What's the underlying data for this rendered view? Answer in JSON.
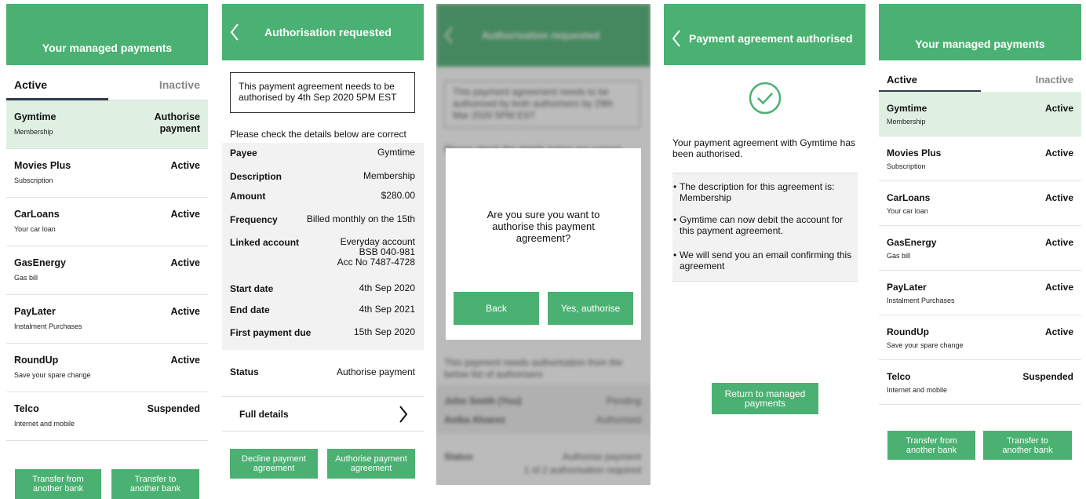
{
  "screen1": {
    "title": "Your managed payments",
    "tab_active": "Active",
    "tab_inactive": "Inactive",
    "rows": [
      {
        "name": "Gymtime",
        "sub": "Membership",
        "status": "Authorise payment"
      },
      {
        "name": "Movies Plus",
        "sub": "Subscription",
        "status": "Active"
      },
      {
        "name": "CarLoans",
        "sub": "Your car loan",
        "status": "Active"
      },
      {
        "name": "GasEnergy",
        "sub": "Gas bill",
        "status": "Active"
      },
      {
        "name": "PayLater",
        "sub": "Instalment Purchases",
        "status": "Active"
      },
      {
        "name": "RoundUp",
        "sub": "Save your spare change",
        "status": "Active"
      },
      {
        "name": "Telco",
        "sub": "Internet and mobile",
        "status": "Suspended"
      }
    ],
    "btn_transfer_from": "Transfer from another bank",
    "btn_transfer_to": "Transfer to another bank"
  },
  "screen2": {
    "title": "Authorisation requested",
    "notice": "This payment agreement needs to be authorised by 4th Sep 2020 5PM EST",
    "check_text": "Please check the details below are correct",
    "details": [
      {
        "label": "Payee",
        "value": "Gymtime"
      },
      {
        "label": "Description",
        "value": "Membership"
      },
      {
        "label": "Amount",
        "value": "$280.00"
      },
      {
        "label": "Frequency",
        "value": "Billed monthly on the 15th"
      },
      {
        "label": "Linked account",
        "value_lines": [
          "Everyday account",
          "BSB 040-981",
          "Acc No 7487-4728"
        ]
      },
      {
        "label": "Start date",
        "value": "4th Sep 2020"
      },
      {
        "label": "End date",
        "value": "4th Sep 2021"
      },
      {
        "label": "First payment due",
        "value": "15th Sep 2020"
      }
    ],
    "status_label": "Status",
    "status_value": "Authorise payment",
    "full_details": "Full details",
    "btn_decline": "Decline payment agreement",
    "btn_authorise": "Authorise payment agreement"
  },
  "screen3": {
    "bg_title": "Authorisation requested",
    "bg_notice": "This payment agreement needs to be authorised by both authorisers by 29th Mar 2020 5PM EST",
    "bg_check": "Please check the details below are correct",
    "bg_authorisers_text": "This payment needs authorisation from the below list of authorisers",
    "bg_authorisers": [
      {
        "name": "John Smith (You)",
        "state": "Pending"
      },
      {
        "name": "Anika Alvarez",
        "state": "Authorised"
      }
    ],
    "bg_status_label": "Status",
    "bg_status_value": "Authorise payment",
    "bg_status_sub": "1 of 2 authorisation required",
    "dialog_question": "Are you sure you want to authorise this payment agreement?",
    "btn_back": "Back",
    "btn_yes": "Yes, authorise"
  },
  "screen4": {
    "title": "Payment agreement authorised",
    "message": "Your payment agreement with Gymtime has been authorised.",
    "bullets": [
      "The description for this agreement is: Membership",
      "Gymtime can now debit the account for this payment agreement.",
      "We will send you an email confirming this agreement"
    ],
    "btn_return": "Return to managed payments"
  },
  "screen5": {
    "title": "Your managed payments",
    "tab_active": "Active",
    "tab_inactive": "Inactive",
    "rows": [
      {
        "name": "Gymtime",
        "sub": "Membership",
        "status": "Active"
      },
      {
        "name": "Movies Plus",
        "sub": "Subscription",
        "status": "Active"
      },
      {
        "name": "CarLoans",
        "sub": "Your car loan",
        "status": "Active"
      },
      {
        "name": "GasEnergy",
        "sub": "Gas bill",
        "status": "Active"
      },
      {
        "name": "PayLater",
        "sub": "Instalment Purchases",
        "status": "Active"
      },
      {
        "name": "RoundUp",
        "sub": "Save your spare change",
        "status": "Active"
      },
      {
        "name": "Telco",
        "sub": "Internet and mobile",
        "status": "Suspended"
      }
    ],
    "btn_transfer_from": "Transfer from another bank",
    "btn_transfer_to": "Transfer to another bank"
  },
  "colors": {
    "brand_green": "#4bb172",
    "highlight": "#dff0e3",
    "tab_underline": "#2f3a4d"
  },
  "icons": [
    "chevron-left-icon",
    "chevron-right-icon",
    "check-circle-icon"
  ]
}
